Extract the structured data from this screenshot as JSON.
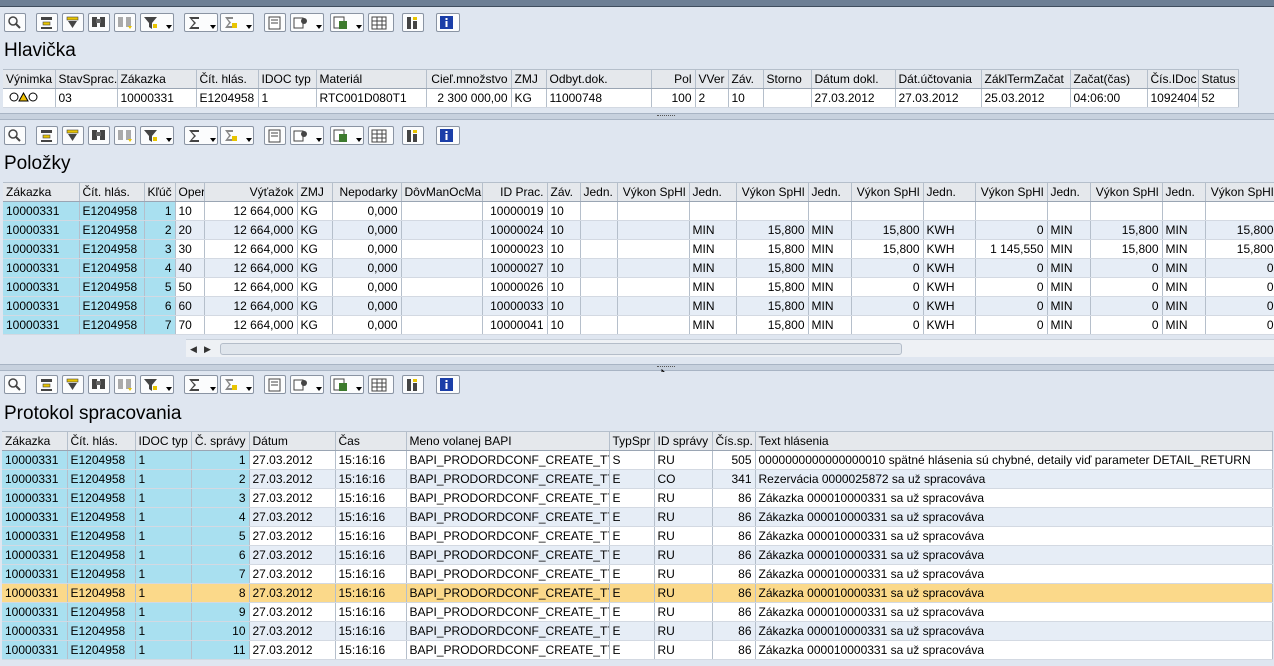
{
  "sections": {
    "header": {
      "title": "Hlavička"
    },
    "items": {
      "title": "Položky"
    },
    "log": {
      "title": "Protokol spracovania"
    }
  },
  "header_table": {
    "columns": [
      "Výnimka",
      "StavSprac.",
      "Zákazka",
      "Čít. hlás.",
      "IDOC typ",
      "Materiál",
      "Cieľ.množstvo",
      "ZMJ",
      "Odbyt.dok.",
      "Pol",
      "VVer",
      "Záv.",
      "Storno",
      "Dátum dokl.",
      "Dát.účtovania",
      "ZáklTermZačat",
      "Začat(čas)",
      "Čís.IDoc",
      "Status"
    ],
    "row": [
      "",
      "03",
      "10000331",
      "E1204958",
      "1",
      "RTC001D080T1",
      "2 300 000,00",
      "KG",
      "11000748",
      "100",
      "2",
      "10",
      "",
      "27.03.2012",
      "27.03.2012",
      "25.03.2012",
      "04:06:00",
      "1092404",
      "52"
    ]
  },
  "items_table": {
    "columns": [
      "Zákazka",
      "Čít. hlás.",
      "Kľúč",
      "Oper",
      "Výťažok",
      "ZMJ",
      "Nepodarky",
      "DôvManOcMa",
      "ID Prac.",
      "Záv.",
      "Jedn.",
      "Výkon SpHl",
      "Jedn.",
      "Výkon SpHl",
      "Jedn.",
      "Výkon SpHl",
      "Jedn.",
      "Výkon SpHl",
      "Jedn.",
      "Výkon SpHl",
      "Jedn.",
      "Výkon SpHl"
    ],
    "rows": [
      [
        "10000331",
        "E1204958",
        "1",
        "10",
        "12 664,000",
        "KG",
        "0,000",
        "",
        "10000019",
        "10",
        "",
        "",
        "",
        "",
        "",
        "",
        "",
        "",
        "",
        "",
        "",
        ""
      ],
      [
        "10000331",
        "E1204958",
        "2",
        "20",
        "12 664,000",
        "KG",
        "0,000",
        "",
        "10000024",
        "10",
        "",
        "",
        "MIN",
        "15,800",
        "MIN",
        "15,800",
        "KWH",
        "0",
        "MIN",
        "15,800",
        "MIN",
        "15,800"
      ],
      [
        "10000331",
        "E1204958",
        "3",
        "30",
        "12 664,000",
        "KG",
        "0,000",
        "",
        "10000023",
        "10",
        "",
        "",
        "MIN",
        "15,800",
        "MIN",
        "15,800",
        "KWH",
        "1 145,550",
        "MIN",
        "15,800",
        "MIN",
        "15,800"
      ],
      [
        "10000331",
        "E1204958",
        "4",
        "40",
        "12 664,000",
        "KG",
        "0,000",
        "",
        "10000027",
        "10",
        "",
        "",
        "MIN",
        "15,800",
        "MIN",
        "0",
        "KWH",
        "0",
        "MIN",
        "0",
        "MIN",
        "0"
      ],
      [
        "10000331",
        "E1204958",
        "5",
        "50",
        "12 664,000",
        "KG",
        "0,000",
        "",
        "10000026",
        "10",
        "",
        "",
        "MIN",
        "15,800",
        "MIN",
        "0",
        "KWH",
        "0",
        "MIN",
        "0",
        "MIN",
        "0"
      ],
      [
        "10000331",
        "E1204958",
        "6",
        "60",
        "12 664,000",
        "KG",
        "0,000",
        "",
        "10000033",
        "10",
        "",
        "",
        "MIN",
        "15,800",
        "MIN",
        "0",
        "KWH",
        "0",
        "MIN",
        "0",
        "MIN",
        "0"
      ],
      [
        "10000331",
        "E1204958",
        "7",
        "70",
        "12 664,000",
        "KG",
        "0,000",
        "",
        "10000041",
        "10",
        "",
        "",
        "MIN",
        "15,800",
        "MIN",
        "0",
        "KWH",
        "0",
        "MIN",
        "0",
        "MIN",
        "0"
      ]
    ]
  },
  "log_table": {
    "columns": [
      "Zákazka",
      "Čít. hlás.",
      "IDOC typ",
      "Č. správy",
      "Dátum",
      "Čas",
      "Meno volanej BAPI",
      "TypSpr",
      "ID správy",
      "Čís.sp.",
      "Text hlásenia"
    ],
    "rows": [
      [
        "10000331",
        "E1204958",
        "1",
        "1",
        "27.03.2012",
        "15:16:16",
        "BAPI_PRODORDCONF_CREATE_TT",
        "S",
        "RU",
        "505",
        "0000000000000000010 spätné hlásenia sú chybné, detaily viď parameter DETAIL_RETURN"
      ],
      [
        "10000331",
        "E1204958",
        "1",
        "2",
        "27.03.2012",
        "15:16:16",
        "BAPI_PRODORDCONF_CREATE_TT",
        "E",
        "CO",
        "341",
        "Rezervácia 0000025872 sa už spracováva"
      ],
      [
        "10000331",
        "E1204958",
        "1",
        "3",
        "27.03.2012",
        "15:16:16",
        "BAPI_PRODORDCONF_CREATE_TT",
        "E",
        "RU",
        "86",
        "Zákazka 000010000331 sa už spracováva"
      ],
      [
        "10000331",
        "E1204958",
        "1",
        "4",
        "27.03.2012",
        "15:16:16",
        "BAPI_PRODORDCONF_CREATE_TT",
        "E",
        "RU",
        "86",
        "Zákazka 000010000331 sa už spracováva"
      ],
      [
        "10000331",
        "E1204958",
        "1",
        "5",
        "27.03.2012",
        "15:16:16",
        "BAPI_PRODORDCONF_CREATE_TT",
        "E",
        "RU",
        "86",
        "Zákazka 000010000331 sa už spracováva"
      ],
      [
        "10000331",
        "E1204958",
        "1",
        "6",
        "27.03.2012",
        "15:16:16",
        "BAPI_PRODORDCONF_CREATE_TT",
        "E",
        "RU",
        "86",
        "Zákazka 000010000331 sa už spracováva"
      ],
      [
        "10000331",
        "E1204958",
        "1",
        "7",
        "27.03.2012",
        "15:16:16",
        "BAPI_PRODORDCONF_CREATE_TT",
        "E",
        "RU",
        "86",
        "Zákazka 000010000331 sa už spracováva"
      ],
      [
        "10000331",
        "E1204958",
        "1",
        "8",
        "27.03.2012",
        "15:16:16",
        "BAPI_PRODORDCONF_CREATE_TT",
        "E",
        "RU",
        "86",
        "Zákazka 000010000331 sa už spracováva"
      ],
      [
        "10000331",
        "E1204958",
        "1",
        "9",
        "27.03.2012",
        "15:16:16",
        "BAPI_PRODORDCONF_CREATE_TT",
        "E",
        "RU",
        "86",
        "Zákazka 000010000331 sa už spracováva"
      ],
      [
        "10000331",
        "E1204958",
        "1",
        "10",
        "27.03.2012",
        "15:16:16",
        "BAPI_PRODORDCONF_CREATE_TT",
        "E",
        "RU",
        "86",
        "Zákazka 000010000331 sa už spracováva"
      ],
      [
        "10000331",
        "E1204958",
        "1",
        "11",
        "27.03.2012",
        "15:16:16",
        "BAPI_PRODORDCONF_CREATE_TT",
        "E",
        "RU",
        "86",
        "Zákazka 000010000331 sa už spracováva"
      ]
    ],
    "selected_row": 7
  },
  "toolbar_icons": [
    "details-icon",
    "sort-ascending-icon",
    "sort-descending-icon",
    "find-icon",
    "find-next-icon",
    "filter-icon",
    "sum-icon",
    "subtotal-icon",
    "print-preview-icon",
    "export-icon",
    "layout-icon",
    "grid-icon",
    "graphic-icon",
    "info-icon"
  ],
  "colors": {
    "key_column": "#a9e0f0",
    "selected_row": "#fbd98a",
    "alt_row": "#e6edf6",
    "background": "#dfe6f0"
  }
}
